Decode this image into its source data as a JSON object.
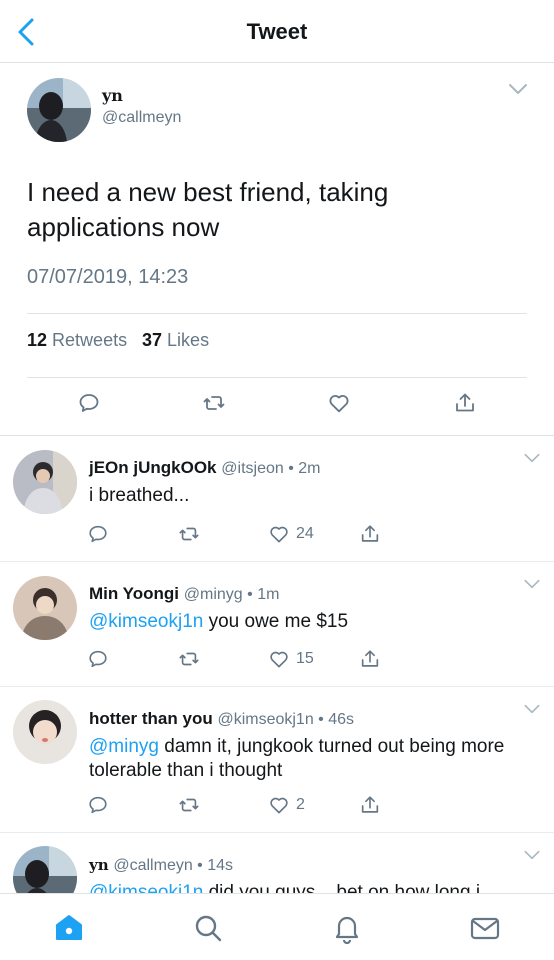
{
  "header": {
    "title": "Tweet"
  },
  "main_tweet": {
    "name": "yn",
    "handle": "@callmeyn",
    "text": "I need a new best friend, taking applications now",
    "timestamp": "07/07/2019, 14:23",
    "retweets_count": "12",
    "retweets_label": "Retweets",
    "likes_count": "37",
    "likes_label": "Likes"
  },
  "replies": [
    {
      "name": "jEOn jUngkOOk",
      "handle": "@itsjeon",
      "time": "2m",
      "mention": "",
      "text": "i breathed...",
      "likes": "24"
    },
    {
      "name": "Min Yoongi",
      "handle": "@minyg",
      "time": "1m",
      "mention": "@kimseokj1n",
      "text": " you owe me $15",
      "likes": "15"
    },
    {
      "name": "hotter than you",
      "handle": "@kimseokj1n",
      "time": "46s",
      "mention": "@minyg",
      "text": " damn it, jungkook turned out being more tolerable than i thought",
      "likes": "2"
    },
    {
      "name": "yn",
      "handle": "@callmeyn",
      "time": "14s",
      "mention": "@kimseokj1n",
      "text": " did you guys... bet on how long i",
      "likes": ""
    }
  ],
  "separator": " • ",
  "colors": {
    "accent": "#1da1f2",
    "text": "#14171a",
    "muted": "#657786",
    "divider": "#dfe3e6"
  },
  "icons": {
    "header": "chevron-left-icon",
    "actions": [
      "reply-icon",
      "retweet-icon",
      "like-icon",
      "share-icon"
    ],
    "tabs": [
      "home-icon",
      "search-icon",
      "notifications-icon",
      "messages-icon"
    ]
  }
}
